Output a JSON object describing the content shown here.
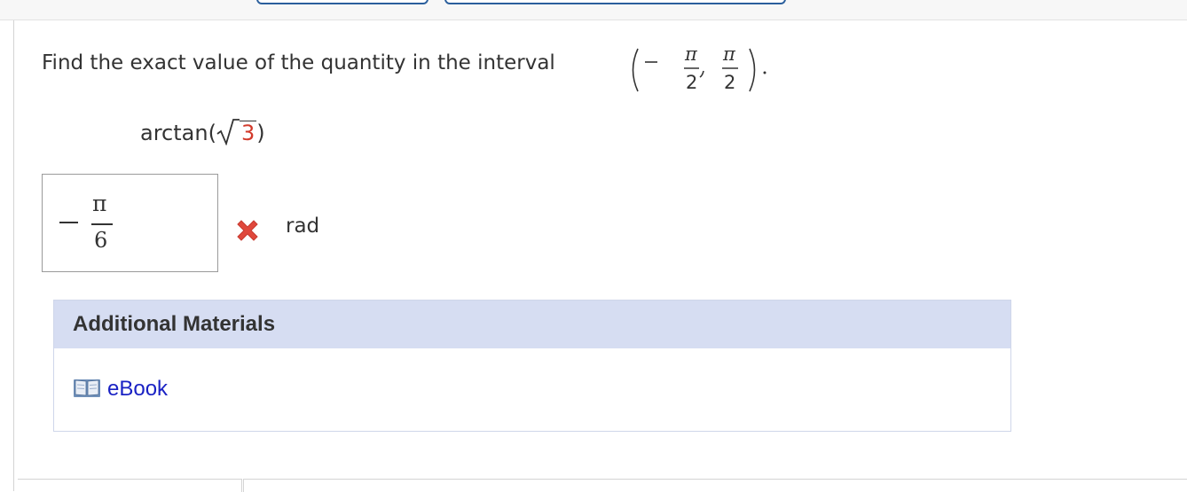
{
  "question": {
    "prompt": "Find the exact value of the quantity in the interval",
    "interval": {
      "open_paren": "(",
      "minus": "−",
      "left_numerator": "π",
      "left_denominator": "2",
      "comma": ",",
      "right_numerator": "π",
      "right_denominator": "2",
      "close_paren": ")",
      "period": "."
    },
    "expression": {
      "function": "arctan(",
      "radicand": "3",
      "close": ")"
    }
  },
  "answer": {
    "numerator": "π",
    "denominator": "6",
    "status_icon": "incorrect-x-icon",
    "unit": "rad"
  },
  "additional_materials": {
    "heading": "Additional Materials",
    "items": [
      {
        "label": "eBook",
        "icon": "book-icon"
      }
    ]
  },
  "colors": {
    "header_bg": "#d6ddf2",
    "link": "#1a22c4",
    "incorrect": "#e0483c",
    "radicand": "#d23a2b",
    "tab_border": "#2a5e9c"
  }
}
